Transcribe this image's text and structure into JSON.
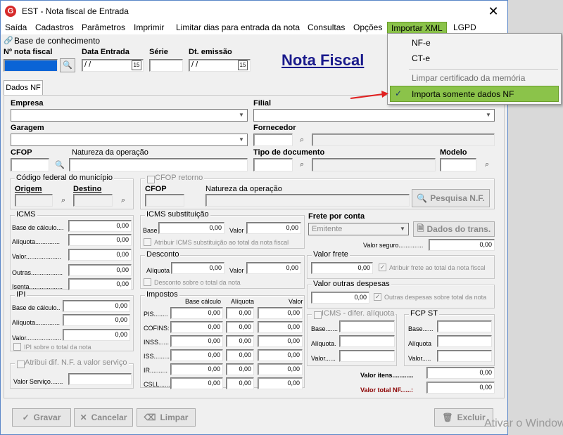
{
  "window": {
    "title": "EST - Nota fiscal de Entrada",
    "close": "✕",
    "app_icon": "G"
  },
  "menu": {
    "items": [
      "Saída",
      "Cadastros",
      "Parâmetros",
      "Imprimir",
      "Limitar dias para entrada da nota",
      "Consultas",
      "Opções",
      "Importar XML",
      "LGPD"
    ]
  },
  "knowledge_base": "Base de conhecimento",
  "header": {
    "nf_label": "Nº nota fiscal",
    "date_label": "Data Entrada",
    "date_value": " / /",
    "serie_label": "Série",
    "emission_label": "Dt. emissão",
    "emission_value": " / /",
    "big_title": "Nota Fiscal"
  },
  "tab": "Dados NF",
  "fields": {
    "empresa": "Empresa",
    "filial": "Filial",
    "garagem": "Garagem",
    "fornecedor": "Fornecedor",
    "cfop": "CFOP",
    "natureza": "Natureza da operação",
    "tipo_doc": "Tipo de documento",
    "modelo": "Modelo"
  },
  "municipio": {
    "caption": "Código federal do município",
    "origem": "Origem",
    "destino": "Destino"
  },
  "cfop_retorno": {
    "caption": "CFOP retorno",
    "cfop": "CFOP",
    "natureza": "Natureza da operação",
    "button": "Pesquisa N.F."
  },
  "icms": {
    "caption": "ICMS",
    "labels": [
      "Base de cálculo....",
      "Alíquota..............",
      "Valor....................",
      "Outras..................",
      "Isenta..................."
    ],
    "values": [
      "0,00",
      "0,00",
      "0,00",
      "0,00",
      "0,00"
    ]
  },
  "icms_st": {
    "caption": "ICMS substituição",
    "base_label": "Base",
    "base_value": "0,00",
    "valor_label": "Valor",
    "valor_value": "0,00",
    "check": "Atribuir ICMS substituição ao total da nota fiscal"
  },
  "desconto": {
    "caption": "Desconto",
    "aliq_label": "Alíquota",
    "aliq_value": "0,00",
    "valor_label": "Valor",
    "valor_value": "0,00",
    "check": "Desconto sobre o total da nota"
  },
  "frete": {
    "title": "Frete por conta",
    "select": "Emitente",
    "button": "Dados do trans.",
    "seguro_label": "Valor seguro..............",
    "seguro_value": "0,00"
  },
  "valor_frete": {
    "caption": "Valor frete",
    "value": "0,00",
    "check": "Atribuir frete ao total da nota fiscal"
  },
  "outras_desp": {
    "caption": "Valor outras despesas",
    "value": "0,00",
    "check": "Outras despesas sobre total da nota"
  },
  "ipi": {
    "caption": "IPI",
    "labels": [
      "Base de cálculo..",
      "Alíquota..............",
      "Valor...................."
    ],
    "values": [
      "0,00",
      "0,00",
      "0,00"
    ],
    "check": "IPI sobre o total da nota"
  },
  "impostos": {
    "caption": "Impostos",
    "col_base": "Base cálculo",
    "col_aliq": "Alíquota",
    "col_valor": "Valor",
    "rows": [
      {
        "label": "PIS........",
        "base": "0,00",
        "aliq": "0,00",
        "valor": "0,00"
      },
      {
        "label": "COFINS:",
        "base": "0,00",
        "aliq": "0,00",
        "valor": "0,00"
      },
      {
        "label": "INSS......",
        "base": "0,00",
        "aliq": "0,00",
        "valor": "0,00"
      },
      {
        "label": "ISS.........",
        "base": "0,00",
        "aliq": "0,00",
        "valor": "0,00"
      },
      {
        "label": "IR..........",
        "base": "0,00",
        "aliq": "0,00",
        "valor": "0,00"
      },
      {
        "label": "CSLL.......",
        "base": "0,00",
        "aliq": "0,00",
        "valor": "0,00"
      }
    ]
  },
  "icms_difer": {
    "caption": "ICMS - difer. alíquota",
    "labels": [
      "Base.......",
      "Alíquota.",
      "Valor......"
    ]
  },
  "fcp_st": {
    "caption": "FCP ST",
    "labels": [
      "Base......",
      "Alíquota",
      "Valor....."
    ]
  },
  "valor_servico": {
    "caption": "Atribui dif. N.F. a valor serviço",
    "label": "Valor Serviço......."
  },
  "totais": {
    "itens_label": "Valor itens............",
    "itens_value": "0,00",
    "total_label": "Valor total NF......:",
    "total_value": "0,00"
  },
  "buttons": {
    "gravar": "Gravar",
    "cancelar": "Cancelar",
    "limpar": "Limpar",
    "excluir": "Excluir"
  },
  "dropdown": {
    "items": [
      "NF-e",
      "CT-e",
      "Limpar certificado da memória",
      "Importa somente dados NF"
    ]
  },
  "watermark": "Ativar o Windows",
  "colors": {
    "highlight": "#8bc34a",
    "title_blue": "#1a1a8c",
    "total_red": "#8b0000"
  }
}
